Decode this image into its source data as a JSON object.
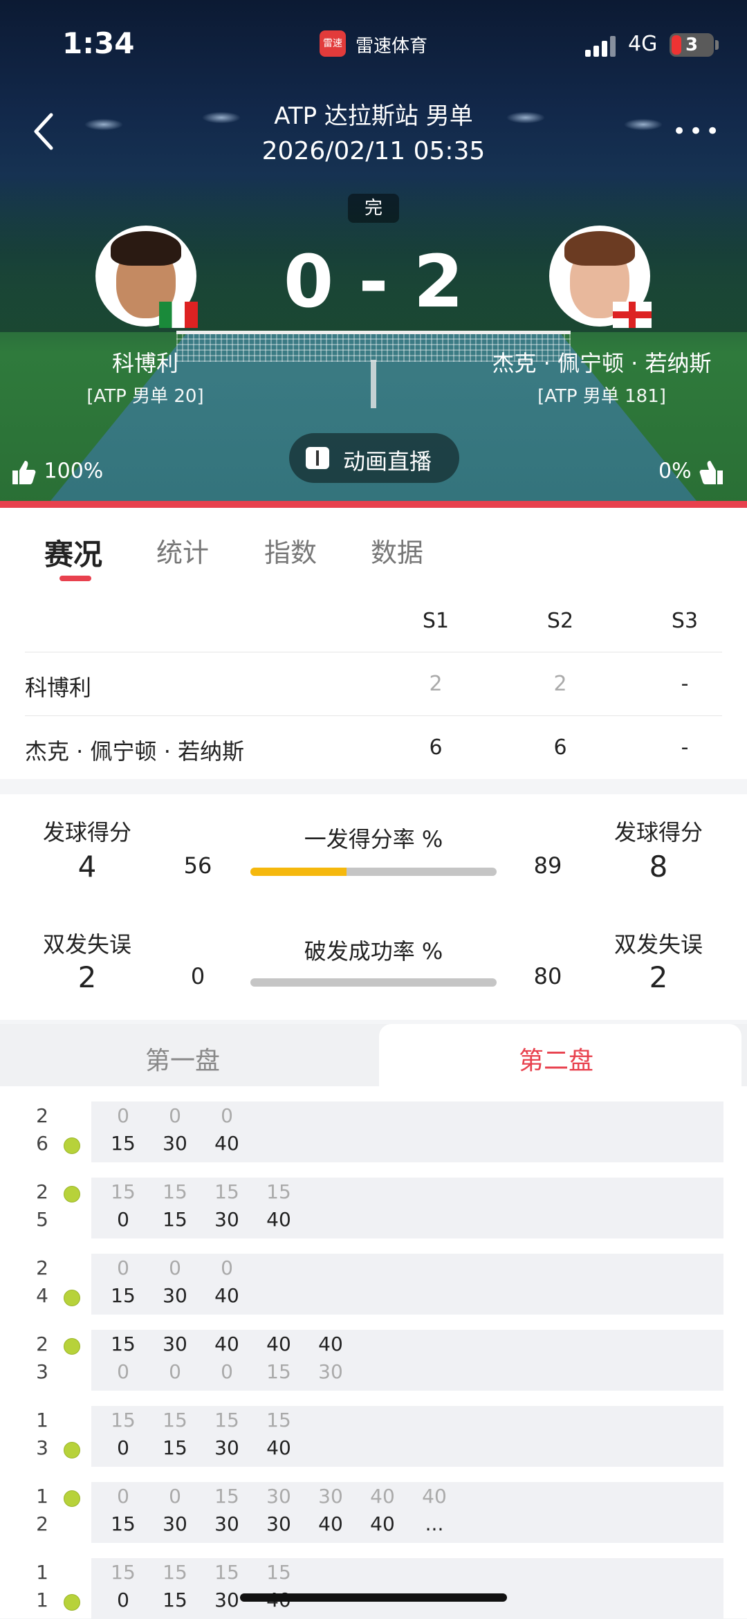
{
  "status_bar": {
    "time": "1:34",
    "app_icon_text": "雷速",
    "app_name": "雷速体育",
    "network": "4G",
    "battery": "3"
  },
  "match": {
    "title": "ATP 达拉斯站 男单",
    "datetime": "2026/02/11 05:35",
    "status": "完",
    "score": "0 - 2"
  },
  "home": {
    "name": "科博利",
    "rank": "[ATP 男单 20]",
    "flag": "Italy",
    "support": "100%"
  },
  "away": {
    "name": "杰克 · 佩宁顿 · 若纳斯",
    "rank": "[ATP 男单 181]",
    "flag": "England",
    "support": "0%"
  },
  "live_button": "动画直播",
  "tabs": [
    "赛况",
    "统计",
    "指数",
    "数据"
  ],
  "set_table": {
    "headers": [
      "S1",
      "S2",
      "S3"
    ],
    "rows": [
      {
        "name": "科博利",
        "values": [
          "2",
          "2",
          "-"
        ]
      },
      {
        "name": "杰克 · 佩宁顿 · 若纳斯",
        "values": [
          "6",
          "6",
          "-"
        ]
      }
    ]
  },
  "stats": {
    "row1": {
      "left_label": "发球得分",
      "left_value": "4",
      "title": "一发得分率 %",
      "left_pct": "56",
      "right_pct": "89",
      "right_label": "发球得分",
      "right_value": "8",
      "bar_fraction": 0.39
    },
    "row2": {
      "left_label": "双发失误",
      "left_value": "2",
      "title": "破发成功率 %",
      "left_pct": "0",
      "right_pct": "80",
      "right_label": "双发失误",
      "right_value": "2",
      "bar_fraction": 0
    }
  },
  "set_tabs": [
    "第一盘",
    "第二盘"
  ],
  "games": [
    {
      "top": "2",
      "bottom": "6",
      "server": "bottom",
      "top_pts": [
        "0",
        "0",
        "0"
      ],
      "bottom_pts": [
        "15",
        "30",
        "40"
      ],
      "winner": "bottom"
    },
    {
      "top": "2",
      "bottom": "5",
      "server": "top",
      "top_pts": [
        "15",
        "15",
        "15",
        "15"
      ],
      "bottom_pts": [
        "0",
        "15",
        "30",
        "40"
      ],
      "winner": "bottom"
    },
    {
      "top": "2",
      "bottom": "4",
      "server": "bottom",
      "top_pts": [
        "0",
        "0",
        "0"
      ],
      "bottom_pts": [
        "15",
        "30",
        "40"
      ],
      "winner": "bottom"
    },
    {
      "top": "2",
      "bottom": "3",
      "server": "top",
      "top_pts": [
        "15",
        "30",
        "40",
        "40",
        "40"
      ],
      "bottom_pts": [
        "0",
        "0",
        "0",
        "15",
        "30"
      ],
      "winner": "top"
    },
    {
      "top": "1",
      "bottom": "3",
      "server": "bottom",
      "top_pts": [
        "15",
        "15",
        "15",
        "15"
      ],
      "bottom_pts": [
        "0",
        "15",
        "30",
        "40"
      ],
      "winner": "bottom"
    },
    {
      "top": "1",
      "bottom": "2",
      "server": "top",
      "top_pts": [
        "0",
        "0",
        "15",
        "30",
        "30",
        "40",
        "40"
      ],
      "bottom_pts": [
        "15",
        "30",
        "30",
        "30",
        "40",
        "40",
        "..."
      ],
      "winner": "bottom"
    },
    {
      "top": "1",
      "bottom": "1",
      "server": "bottom",
      "top_pts": [
        "15",
        "15",
        "15",
        "15"
      ],
      "bottom_pts": [
        "0",
        "15",
        "30",
        "40"
      ],
      "winner": "bottom"
    }
  ],
  "colors": {
    "accent": "#e8414e",
    "bar_fill": "#f5b80d",
    "bar_track": "#c5c5c5",
    "ball": "#b7d23a"
  }
}
